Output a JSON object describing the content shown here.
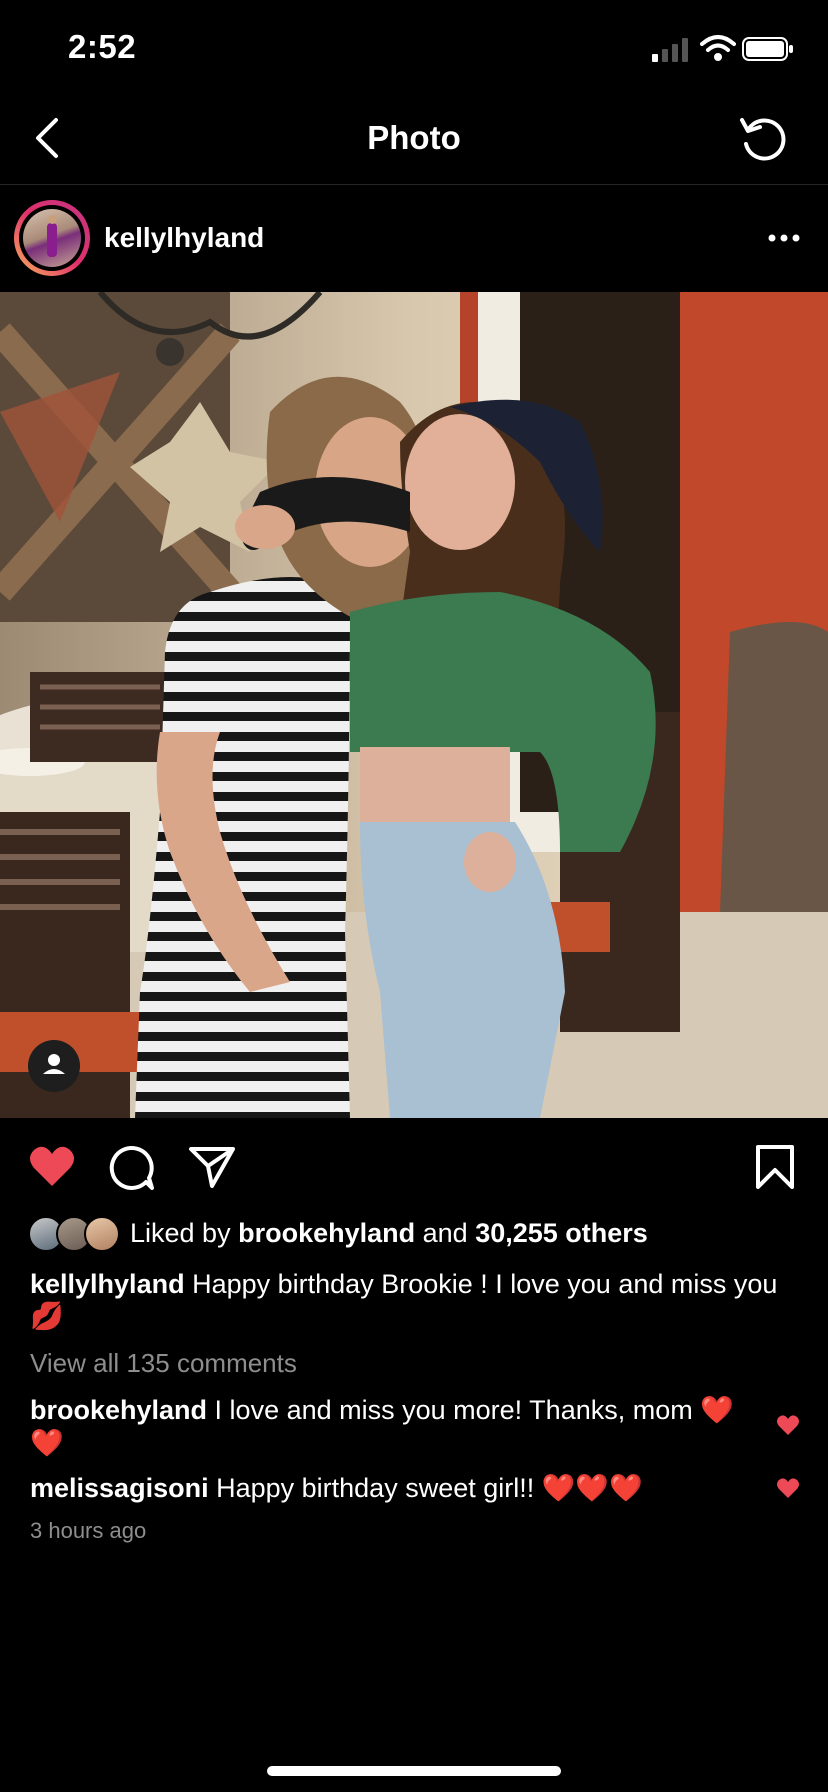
{
  "status_bar": {
    "time": "2:52"
  },
  "nav": {
    "title": "Photo"
  },
  "post": {
    "author": "kellylhyland",
    "likes": {
      "prefix": "Liked by",
      "user": "brookehyland",
      "connector": "and",
      "others": "30,255 others"
    },
    "caption": {
      "user": "kellylhyland",
      "text": "Happy birthday Brookie !  I love you and miss you 💋"
    },
    "view_comments": "View all 135 comments",
    "comments": [
      {
        "user": "brookehyland",
        "text": "I love and miss you more! Thanks, mom ❤️❤️"
      },
      {
        "user": "melissagisoni",
        "text": "Happy birthday sweet girl!! ❤️❤️❤️"
      }
    ],
    "timestamp": "3 hours ago"
  },
  "colors": {
    "like_red": "#ED4956",
    "background": "#000000",
    "muted": "#8E8E8E"
  },
  "icons": [
    "signal-icon",
    "wifi-icon",
    "battery-icon",
    "back-chevron-icon",
    "refresh-icon",
    "more-icon",
    "user-tag-icon",
    "heart-icon",
    "comment-icon",
    "share-icon",
    "bookmark-icon"
  ]
}
